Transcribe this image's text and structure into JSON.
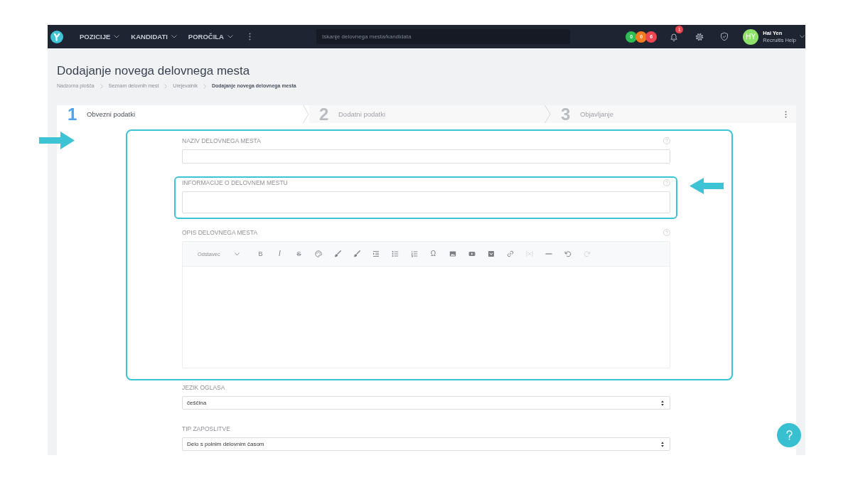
{
  "top_bar": {
    "menu": [
      "POZICIJE",
      "KANDIDATI",
      "POROČILA"
    ],
    "search": {
      "placeholder": "Iskanje delovnega mesta/kandidata"
    },
    "counters": [
      {
        "value": "0",
        "color": "#2dbd52"
      },
      {
        "value": "0",
        "color": "#f47b20"
      },
      {
        "value": "6",
        "color": "#ec4650"
      }
    ],
    "notifications": {
      "count": "1"
    },
    "user": {
      "initials": "HY",
      "name": "Hai Yen",
      "subtitle": "Recruitis Help"
    }
  },
  "page": {
    "title": "Dodajanje novega delovnega mesta",
    "breadcrumb": [
      {
        "label": "Nadzorna plošča",
        "current": false
      },
      {
        "label": "Seznam delovnih mest",
        "current": false
      },
      {
        "label": "Urejevalnik",
        "current": false
      },
      {
        "label": "Dodajanje novega delovnega mesta",
        "current": true
      }
    ]
  },
  "steps": [
    {
      "number": "1",
      "label": "Obvezni podatki",
      "selected": true
    },
    {
      "number": "2",
      "label": "Dodatni podatki",
      "selected": false
    },
    {
      "number": "3",
      "label": "Objavljanje",
      "selected": false
    }
  ],
  "form": {
    "fields": [
      {
        "kind": "text",
        "label": "NAZIV DELOVNEGA MESTA",
        "help": true
      },
      {
        "kind": "textarea",
        "label": "INFORMACIJE O DELOVNEM MESTU",
        "help": true
      },
      {
        "kind": "editor",
        "label": "OPIS DELOVNEGA MESTA",
        "help": true,
        "format": "Odstavec",
        "tools": [
          {
            "kind": "bold",
            "label": "B",
            "disabled": false
          },
          {
            "kind": "italic",
            "label": "I",
            "disabled": false
          },
          {
            "kind": "strike",
            "label": "S",
            "disabled": false
          },
          {
            "kind": "palette",
            "disabled": false
          },
          {
            "kind": "brush",
            "disabled": false
          },
          {
            "kind": "brush",
            "disabled": false
          },
          {
            "kind": "indent",
            "disabled": false
          },
          {
            "kind": "bullets",
            "disabled": false
          },
          {
            "kind": "numbers",
            "disabled": false
          },
          {
            "kind": "omega",
            "label": "Ω",
            "disabled": false
          },
          {
            "kind": "image",
            "disabled": false
          },
          {
            "kind": "video",
            "disabled": false
          },
          {
            "kind": "embed",
            "disabled": false
          },
          {
            "kind": "link",
            "disabled": false
          },
          {
            "kind": "unlink",
            "disabled": true
          },
          {
            "kind": "rule",
            "disabled": false
          },
          {
            "kind": "undo",
            "disabled": false
          },
          {
            "kind": "redo",
            "disabled": true
          }
        ]
      },
      {
        "kind": "select",
        "label": "JEZIK OGLASA",
        "help": false,
        "value": "češčina"
      },
      {
        "kind": "select",
        "label": "TIP ZAPOSLITVE",
        "help": false,
        "value": "Delo s polnim delovnim časom"
      }
    ]
  },
  "annotations": [
    {
      "kind": "bigframe"
    },
    {
      "kind": "smallframe"
    },
    {
      "kind": "rightarrow"
    },
    {
      "kind": "leftarrow"
    }
  ]
}
